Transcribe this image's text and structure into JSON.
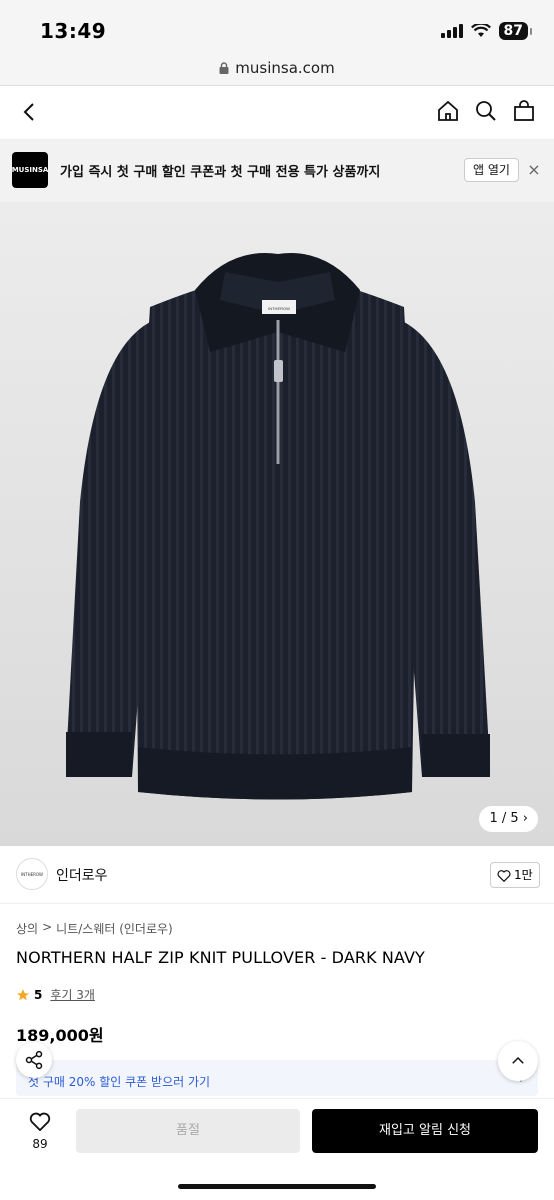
{
  "status": {
    "time": "13:49",
    "battery": "87"
  },
  "browser": {
    "url": "musinsa.com"
  },
  "banner": {
    "logo_text": "MUSINSA",
    "message": "가입 즉시 첫 구매 할인 쿠폰과 첫 구매 전용 특가 상품까지",
    "open_app_label": "앱 열기",
    "close_label": "×"
  },
  "gallery": {
    "counter": "1 / 5",
    "zipper_tag": "INTHEROW"
  },
  "brand": {
    "logo_text": "INTHEROW",
    "name": "인더로우",
    "like_count": "1만"
  },
  "product": {
    "breadcrumb": [
      "상의",
      "니트/스웨터 (인더로우)"
    ],
    "breadcrumb_separator": ">",
    "title": "NORTHERN HALF ZIP KNIT PULLOVER - DARK NAVY",
    "rating_score": "5",
    "review_link": "후기 3개",
    "price": "189,000원"
  },
  "coupon": {
    "text": "첫 구매 20% 할인 쿠폰 받으러 가기"
  },
  "bottom": {
    "wish_count": "89",
    "soldout_label": "품절",
    "restock_label": "재입고 알림 신청"
  },
  "colors": {
    "accent": "#2a5bd7",
    "primary": "#000000",
    "star": "#f5a623",
    "sweater": "#1c2230"
  }
}
